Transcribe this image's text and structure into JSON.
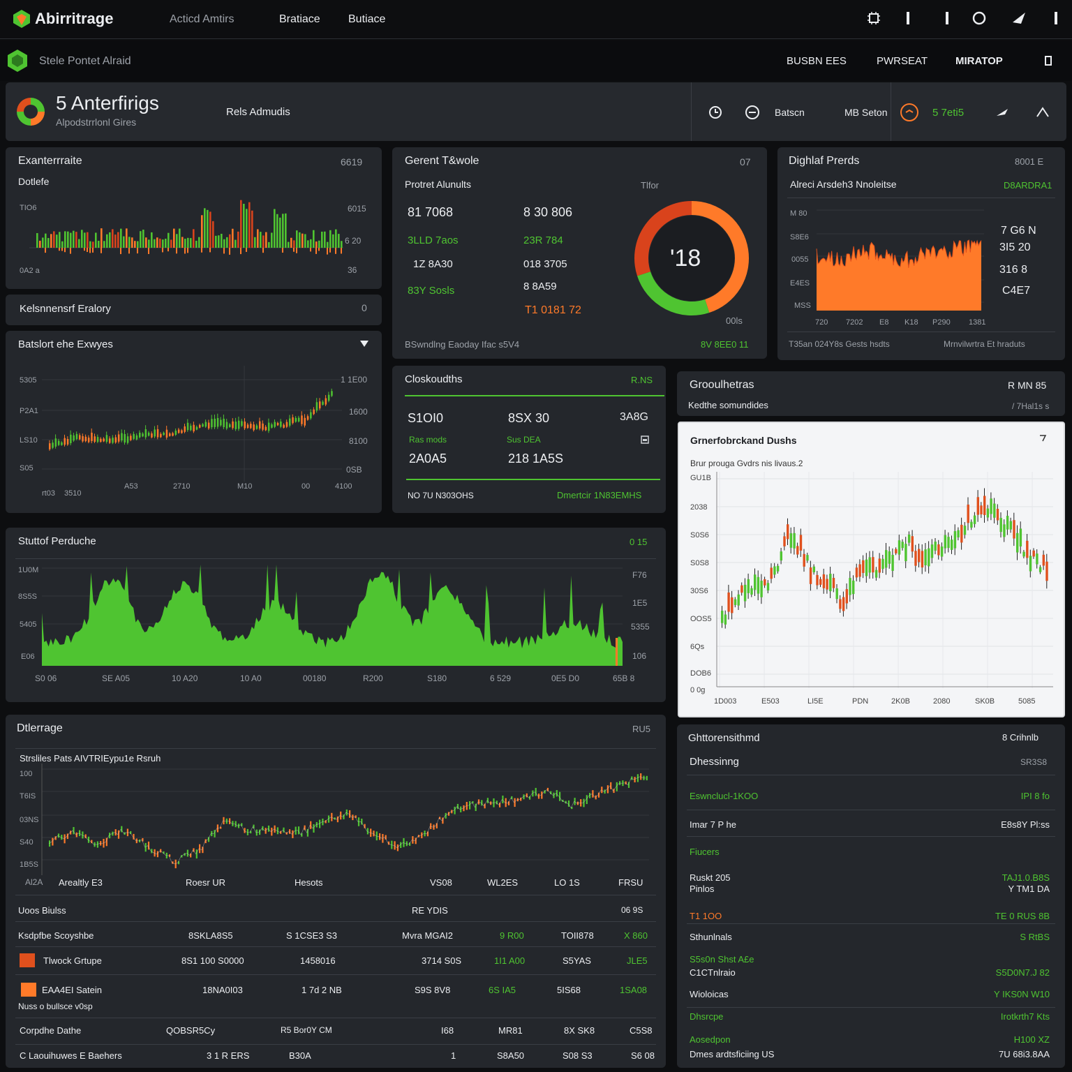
{
  "topbar": {
    "brand": "Abirritrage",
    "nav": [
      "Acticd Amtirs",
      "Bratiace",
      "Butiace"
    ]
  },
  "subbar": {
    "title": "Stele Pontet Alraid",
    "links": [
      "BUSBN EES",
      "PWRSEAT",
      "MIRATOP"
    ]
  },
  "header": {
    "title": "5 Anterfirigs",
    "subtitle": "Alpodstrrlonl Gires",
    "center_label": "Rels Admudis",
    "tools": [
      "Batscn",
      "MB Seton"
    ],
    "status": "5 7eti5"
  },
  "panel_exchange": {
    "title": "Exanterrraite",
    "value": "6619",
    "sub": "Dotlefe",
    "y_left": [
      "TIO6",
      "0A2 a"
    ],
    "y_right": [
      "6015",
      "6 20",
      "36"
    ]
  },
  "panel_keyboard": {
    "title": "Kelsnnensrf Eralory",
    "value": "0"
  },
  "panel_exchanges": {
    "title": "Batslort ehe Exwyes",
    "y_left": [
      "5305",
      "P2A1",
      "LS10",
      "S05"
    ],
    "y_right": [
      "1 1E00",
      "1600",
      "8100",
      "0SB"
    ],
    "x": [
      "rt03",
      "3510",
      "A53",
      "2710",
      "M10",
      "00",
      "4100"
    ]
  },
  "panel_trade": {
    "title": "Gerent T&wole",
    "num": "07",
    "sub": "Protret Alunults",
    "right_label": "Tlfor",
    "col1": [
      "81 7068",
      "3LLD 7aos",
      "1Z 8A30",
      "83Y Sosls"
    ],
    "col2": [
      "8 30 806",
      "23R 784",
      "018 3705",
      "8 8A59",
      "T1 0181 72"
    ],
    "gauge_value": "'18",
    "gauge_label": "00ls",
    "gauge_segments": [
      {
        "value": 45,
        "color": "#ff7a29"
      },
      {
        "value": 25,
        "color": "#4fc431"
      },
      {
        "value": 30,
        "color": "#d9431c"
      }
    ],
    "footer_left": "BSwndlng Eaoday Ifac s5V4",
    "footer_right": "8V 8EE0 11"
  },
  "panel_digital": {
    "title": "Dighlaf Prerds",
    "value": "8001 E",
    "sub": "Alreci Arsdeh3 Nnoleitse",
    "sub_right": "D8ARDRA1",
    "y_left": [
      "M 80",
      "S8E6",
      "0055",
      "E4ES",
      "MSS"
    ],
    "values_right": [
      "7 G6 N",
      "3I5 20",
      "316 8",
      "C4E7"
    ],
    "x": [
      "720",
      "7202",
      "E8",
      "K18",
      "P290",
      "1381"
    ],
    "footer_left": "T35an 024Y8s Gests hsdts",
    "footer_right": "Mrnvilwrtra Et hraduts"
  },
  "panel_cloud": {
    "title": "Closkoudths",
    "tag": "R.NS",
    "row1": [
      "S1OI0",
      "8SX 30",
      "3A8G"
    ],
    "row2_labels": [
      "Ras mods",
      "Sus DEA"
    ],
    "row2": [
      "2A0A5",
      "218 1A5S"
    ],
    "footer_left": "NO 7U N303OHS",
    "footer_right": "Dmertcir 1N83EMHS"
  },
  "panel_growth": {
    "title": "Grooulhetras",
    "value": "R MN 85",
    "sub": "Kedthe somundides",
    "sub_right": "/ 7Hal1s s"
  },
  "panel_candles": {
    "title": "Grnerfobrckand Dushs",
    "sub": "Brur prouga Gvdrs nis livaus.2",
    "y": [
      "GU1B",
      "2038",
      "S0S6",
      "S0S8",
      "30S6",
      "OOS5",
      "6Qs",
      "DOB6",
      "0 0g"
    ],
    "x": [
      "1D003",
      "E503",
      "LI5E",
      "PDN",
      "2K0B",
      "2080",
      "SK0B",
      "5085"
    ]
  },
  "panel_spot": {
    "title": "Stuttof Perduche",
    "value": "0 15",
    "y_left": [
      "1U0M",
      "8S5S",
      "5405",
      "E06"
    ],
    "y_right": [
      "F76",
      "1E5",
      "5355",
      "106"
    ],
    "x": [
      "S0 06",
      "SE A05",
      "10 A20",
      "10 A0",
      "00180",
      "R200",
      "S180",
      "6 529",
      "0E5 D0",
      "65B 8"
    ]
  },
  "panel_exchange2": {
    "title": "Dtlerrage",
    "value": "RU5",
    "sub": "Strsliles Pats AIVTRIEypu1e Rsruh",
    "y": [
      "100",
      "T6IS",
      "03NS",
      "S40",
      "1B5S",
      "Al2A"
    ],
    "x": [
      "Arealtly E3",
      "Roesr UR",
      "Hesots",
      "VS08",
      "WL2ES",
      "LO 1S",
      "FRSU"
    ],
    "table_header": [
      "Uoos Biulss",
      "RE YDIS",
      "06 9S"
    ],
    "rows": [
      {
        "name": "Ksdpfbe Scoyshbe",
        "c": [
          "8SKLA8S5",
          "S 1CSE3 S3",
          "Mvra MGAI2",
          "9 R00",
          "TOII878",
          "X 860"
        ],
        "swatch": ""
      },
      {
        "name": "Tlwock Grtupe",
        "c": [
          "8S1 100 S0000",
          "1458016",
          "3714 S0S",
          "1I1 A00",
          "S5YAS",
          "JLE5"
        ],
        "swatch": "#e0501d"
      },
      {
        "name": "EAA4EI Satein",
        "c": [
          "18NA0I03",
          "1 7d 2 NB",
          "S9S 8V8",
          "6S IA5",
          "5IS68",
          "1SA08"
        ],
        "swatch": "#ff7a29"
      },
      {
        "name": "Corpdhe Dathe",
        "c": [
          "QOBSR5Cy",
          "R5 Bor0Y CM",
          "I68",
          "MR81",
          "8X SK8",
          "C5S8"
        ],
        "swatch": ""
      },
      {
        "name": "C Laouihuwes E Baehers",
        "c": [
          "3 1 R ERS",
          "B30A",
          "1",
          "S8A50",
          "S08 S3",
          "S6 08"
        ],
        "swatch": ""
      }
    ],
    "row_note": "Nuss o bullsce v0sp"
  },
  "panel_chart_trend": {
    "title": "Ghttorensithmd",
    "value": "8 Crihnlb",
    "sub": "Dhessinng",
    "sub_right": "SR3S8",
    "rows": [
      {
        "label": "Eswnclucl-1KOO",
        "value": "IPI 8 fo",
        "lc": "g",
        "vc": "g"
      },
      {
        "label": "Imar 7 P he",
        "value": "E8s8Y Pl:ss",
        "lc": "w",
        "vc": "w"
      },
      {
        "label": "Fiucers",
        "value": "",
        "lc": "g",
        "vc": "w"
      },
      {
        "label": "Ruskt 205",
        "value": "TAJ1.0.B8S",
        "lc": "w",
        "vc": "g"
      },
      {
        "label": "Pinlos",
        "value": "Y TM1 DA",
        "lc": "w",
        "vc": "w"
      },
      {
        "label": "T1 1OO",
        "value": "TE 0 RUS 8B",
        "lc": "o",
        "vc": "g"
      },
      {
        "label": "Sthunlnals",
        "value": "S RtBS",
        "lc": "w",
        "vc": "g"
      },
      {
        "label": "S5s0n Shst A£e",
        "value": "",
        "lc": "g",
        "vc": "w"
      },
      {
        "label": "C1CTnlraio",
        "value": "S5D0N7.J 82",
        "lc": "w",
        "vc": "g"
      },
      {
        "label": "Wioloicas",
        "value": "Y IKS0N W10",
        "lc": "w",
        "vc": "g"
      },
      {
        "label": "Dhsrcpe",
        "value": "Irotkrth7 Kts",
        "lc": "g",
        "vc": "g"
      },
      {
        "label": "Aosedpon",
        "value": "H100 XZ",
        "lc": "g",
        "vc": "g"
      },
      {
        "label": "Dmes ardtsficiing US",
        "value": "7U 68i3.8AA",
        "lc": "w",
        "vc": "w"
      }
    ]
  },
  "colors": {
    "green": "#4fc431",
    "orange": "#ff7a29",
    "panel": "#24272c",
    "bg": "#0d0e10"
  },
  "icons": [
    "logo-icon",
    "chip-icon",
    "menu-dot-icon",
    "circle-icon",
    "send-icon",
    "kebab-icon",
    "refresh-icon",
    "clock-icon",
    "close-icon",
    "arrow-icon",
    "up-icon",
    "dropdown-icon",
    "expand-icon",
    "edit-icon"
  ]
}
